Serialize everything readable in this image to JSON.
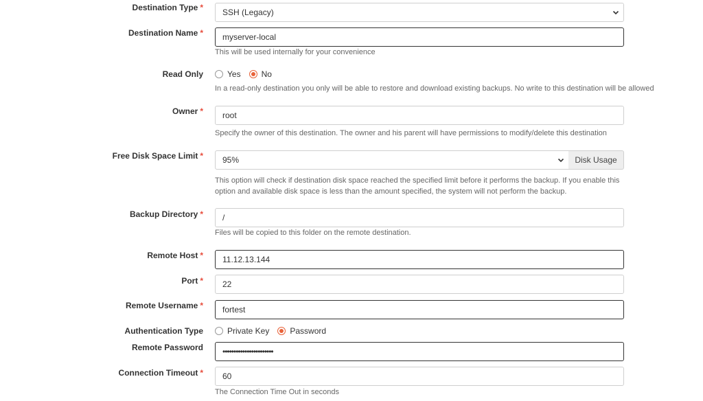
{
  "form": {
    "destination_type": {
      "label": "Destination Type",
      "value": "SSH (Legacy)"
    },
    "destination_name": {
      "label": "Destination Name",
      "value": "myserver-local",
      "help": "This will be used internally for your convenience"
    },
    "read_only": {
      "label": "Read Only",
      "options": [
        "Yes",
        "No"
      ],
      "selected": "No",
      "help": "In a read-only destination you only will be able to restore and download existing backups. No write to this destination will be allowed"
    },
    "owner": {
      "label": "Owner",
      "value": "root",
      "help": "Specify the owner of this destination. The owner and his parent will have permissions to modify/delete this destination"
    },
    "free_disk_space_limit": {
      "label": "Free Disk Space Limit",
      "value": "95%",
      "button_label": "Disk Usage",
      "help_line1": "This option will check if destination disk space reached the specified limit before it performs the backup. If you enable this",
      "help_line2": "option and available disk space is less than the amount specified, the system will not perform the backup."
    },
    "backup_directory": {
      "label": "Backup Directory",
      "value": "/",
      "help": "Files will be copied to this folder on the remote destination."
    },
    "remote_host": {
      "label": "Remote Host",
      "value": "11.12.13.144"
    },
    "port": {
      "label": "Port",
      "value": "22"
    },
    "remote_username": {
      "label": "Remote Username",
      "value": "fortest"
    },
    "authentication_type": {
      "label": "Authentication Type",
      "options": [
        "Private Key",
        "Password"
      ],
      "selected": "Password"
    },
    "remote_password": {
      "label": "Remote Password",
      "value": "•••••••••••••••••••••••"
    },
    "connection_timeout": {
      "label": "Connection Timeout",
      "value": "60",
      "help": "The Connection Time Out in seconds"
    },
    "required_marker": "*"
  },
  "colors": {
    "required": "#e74c3c",
    "radio_accent": "#e8633a",
    "border": "#cfcfcf",
    "focused_border": "#333333",
    "addon_bg": "#eeeeee"
  },
  "icons": {
    "select_arrow": "chevron-down-icon"
  }
}
